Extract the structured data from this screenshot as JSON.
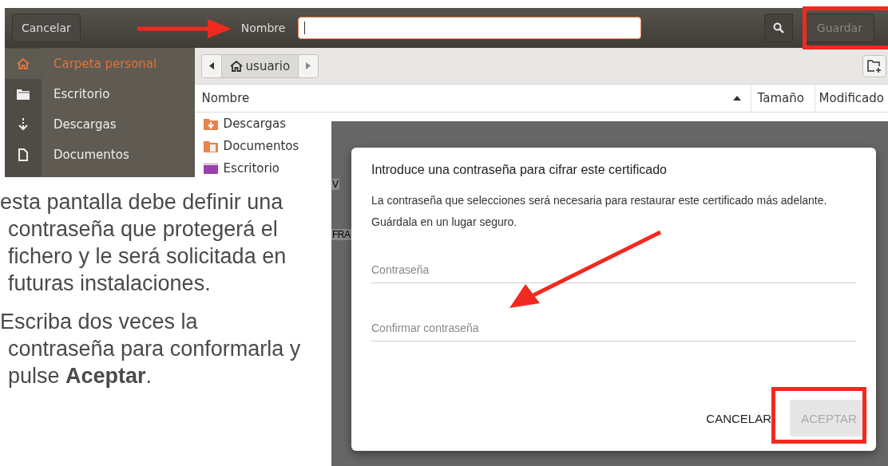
{
  "file_chooser": {
    "cancel_button": "Cancelar",
    "name_label": "Nombre",
    "save_button": {
      "label": "Guardar",
      "disabled": true
    },
    "sidebar": {
      "items": [
        {
          "label": "Carpeta personal",
          "kind": "home",
          "selected": true
        },
        {
          "label": "Escritorio",
          "kind": "folder",
          "selected": false
        },
        {
          "label": "Descargas",
          "kind": "download",
          "selected": false
        },
        {
          "label": "Documentos",
          "kind": "document",
          "selected": false
        }
      ]
    },
    "path_bar": {
      "segment": "usuario"
    },
    "columns": [
      "Nombre",
      "Tamaño",
      "Modificado"
    ],
    "files": [
      {
        "name": "Descargas",
        "kind": "downloads"
      },
      {
        "name": "Documentos",
        "kind": "documents"
      },
      {
        "name": "Escritorio",
        "kind": "desktop"
      }
    ]
  },
  "instructions": [
    "esta pantalla debe definir una contraseña que protegerá el fichero y le será solicitada en futuras instalaciones.",
    "Escriba dos veces la contraseña para conformarla y pulse **Aceptar**."
  ],
  "background_fragments": [
    "V",
    "FRA"
  ],
  "dialog": {
    "title": "Introduce una contraseña para cifrar este certificado",
    "message": "La contraseña que selecciones será necesaria para restaurar este certificado más adelante. Guárdala en un lugar seguro.",
    "fields": [
      {
        "placeholder": "Contraseña"
      },
      {
        "placeholder": "Confirmar contraseña"
      }
    ],
    "buttons": [
      {
        "label": "CANCELAR",
        "kind": "text",
        "disabled": false
      },
      {
        "label": "ACEPTAR",
        "kind": "contained",
        "disabled": true
      }
    ]
  }
}
